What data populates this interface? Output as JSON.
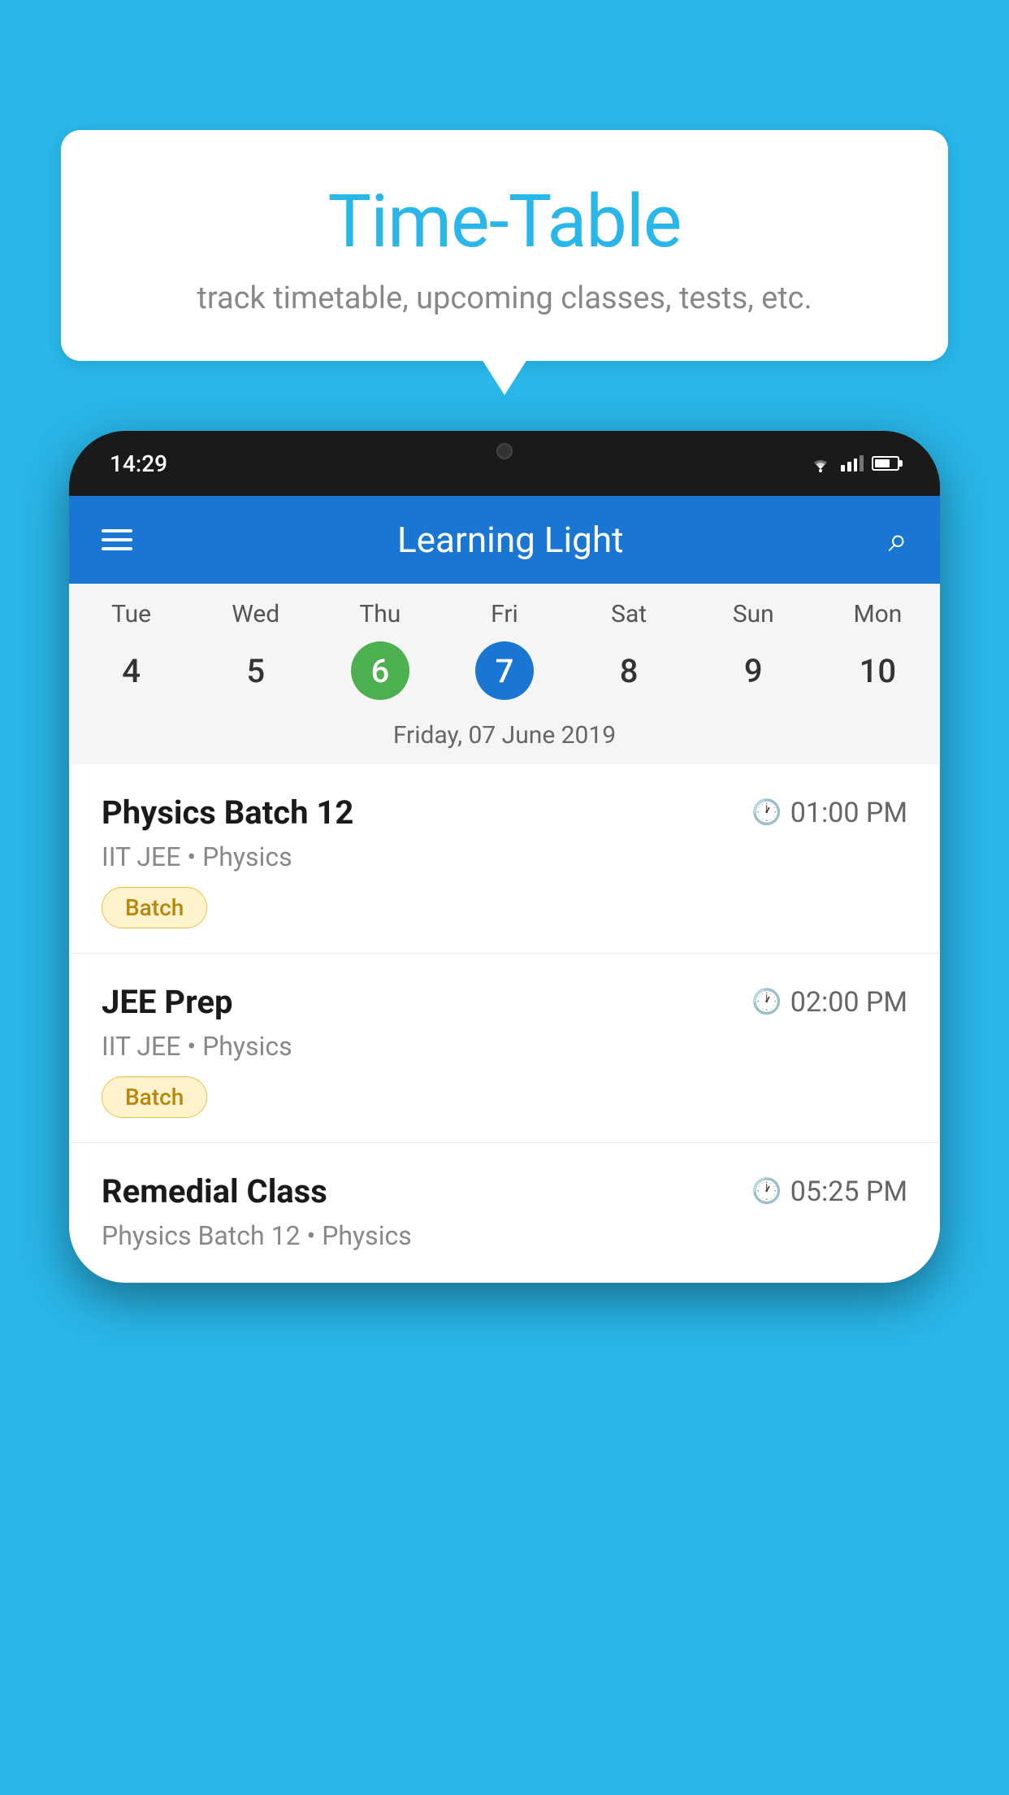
{
  "background_color": "#29B6E8",
  "speech_bubble": {
    "title": "Time-Table",
    "subtitle": "track timetable, upcoming classes, tests, etc."
  },
  "phone": {
    "status_bar": {
      "time": "14:29"
    },
    "app_header": {
      "title": "Learning Light"
    },
    "calendar": {
      "days": [
        "Tue",
        "Wed",
        "Thu",
        "Fri",
        "Sat",
        "Sun",
        "Mon"
      ],
      "dates": [
        "4",
        "5",
        "6",
        "7",
        "8",
        "9",
        "10"
      ],
      "today_index": 2,
      "selected_index": 3,
      "selected_date_label": "Friday, 07 June 2019"
    },
    "schedule_items": [
      {
        "title": "Physics Batch 12",
        "time": "01:00 PM",
        "subtitle": "IIT JEE • Physics",
        "tag": "Batch"
      },
      {
        "title": "JEE Prep",
        "time": "02:00 PM",
        "subtitle": "IIT JEE • Physics",
        "tag": "Batch"
      },
      {
        "title": "Remedial Class",
        "time": "05:25 PM",
        "subtitle": "Physics Batch 12 • Physics",
        "tag": null
      }
    ]
  }
}
